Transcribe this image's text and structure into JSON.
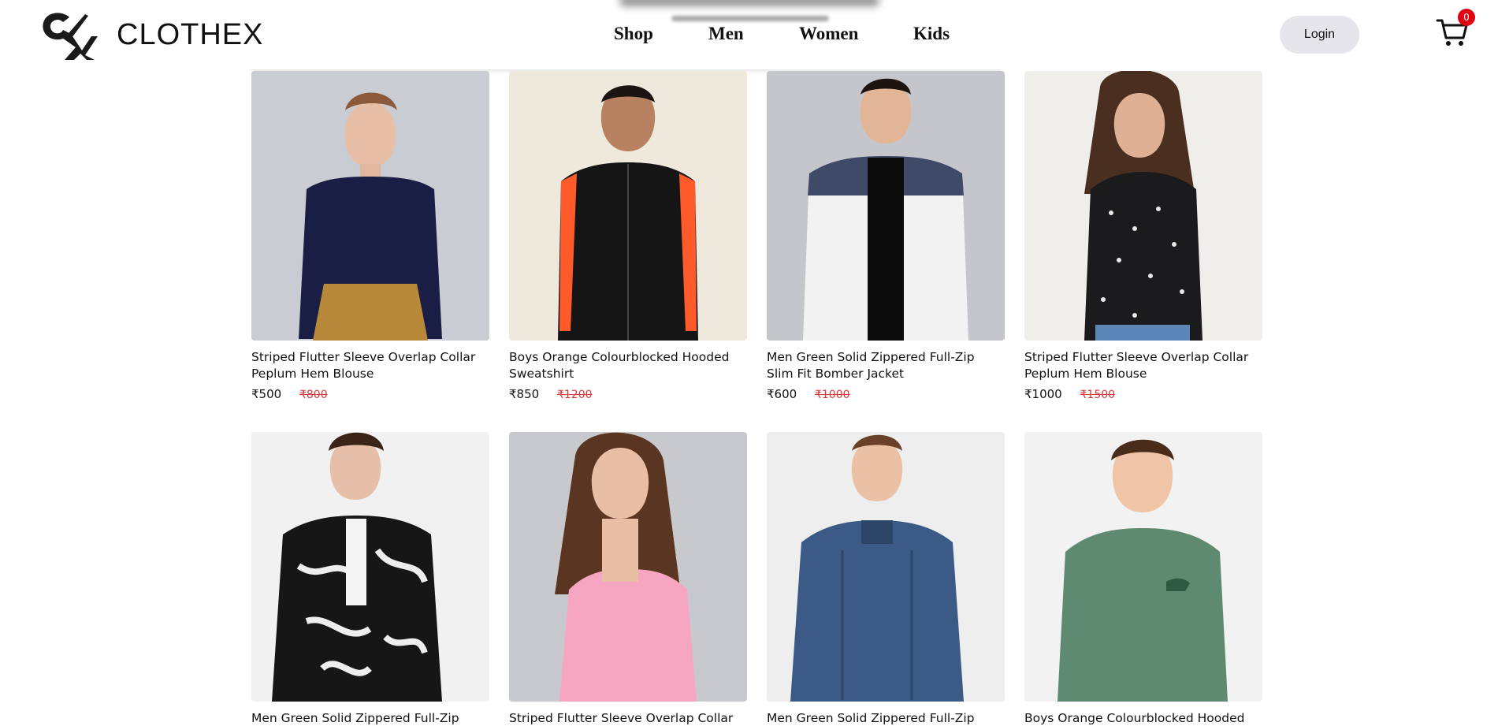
{
  "brand": {
    "name": "CLOTHEX"
  },
  "nav": {
    "items": [
      {
        "label": "Shop"
      },
      {
        "label": "Men"
      },
      {
        "label": "Women"
      },
      {
        "label": "Kids"
      }
    ]
  },
  "header": {
    "login_label": "Login",
    "cart_count": "0"
  },
  "colors": {
    "accent_price_old": "#d23a3a",
    "cart_badge": "#e0000f",
    "login_bg": "#e6e6ea"
  },
  "products": [
    {
      "title": "Striped Flutter Sleeve Overlap Collar Peplum Hem Blouse",
      "price": "₹500",
      "old_price": "₹800",
      "image": "woman-navy-top"
    },
    {
      "title": "Boys Orange Colourblocked Hooded Sweatshirt",
      "price": "₹850",
      "old_price": "₹1200",
      "image": "boy-black-jacket"
    },
    {
      "title": "Men Green Solid Zippered Full-Zip Slim Fit Bomber Jacket",
      "price": "₹600",
      "old_price": "₹1000",
      "image": "man-white-puffer"
    },
    {
      "title": "Striped Flutter Sleeve Overlap Collar Peplum Hem Blouse",
      "price": "₹1000",
      "old_price": "₹1500",
      "image": "woman-floral-top"
    },
    {
      "title": "Men Green Solid Zippered Full-Zip Slim Fit Bomber Jacket",
      "price": "",
      "old_price": "",
      "image": "man-print-bomber"
    },
    {
      "title": "Striped Flutter Sleeve Overlap Collar Peplum Hem Blouse",
      "price": "",
      "old_price": "",
      "image": "woman-pink-top"
    },
    {
      "title": "Men Green Solid Zippered Full-Zip Slim Fit Bomber Jacket",
      "price": "",
      "old_price": "",
      "image": "man-denim-jacket"
    },
    {
      "title": "Boys Orange Colourblocked Hooded Sweatshirt",
      "price": "",
      "old_price": "",
      "image": "boy-green-sweatshirt"
    }
  ]
}
